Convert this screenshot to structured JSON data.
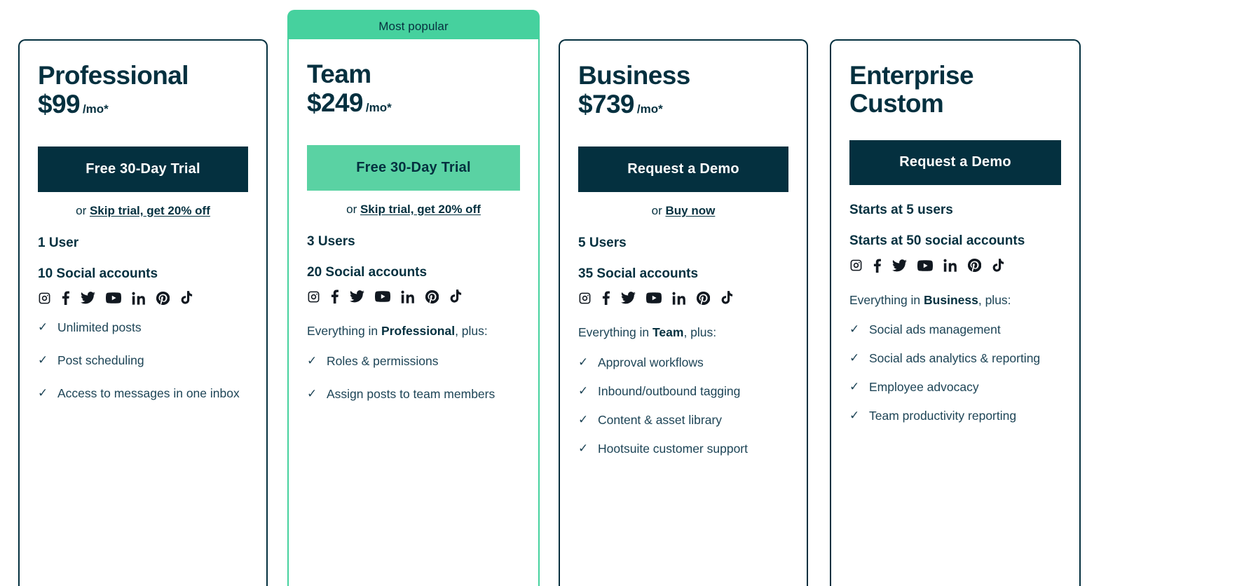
{
  "theme": {
    "dark": "#04303f",
    "green": "#46d19e",
    "button_green": "#5ad2a3",
    "body_text": "#1d4456",
    "card_bg": "#ffffff"
  },
  "badge": {
    "label": "Most popular"
  },
  "social_icons": [
    "instagram-icon",
    "facebook-icon",
    "twitter-icon",
    "youtube-icon",
    "linkedin-icon",
    "pinterest-icon",
    "tiktok-icon"
  ],
  "plans": [
    {
      "name": "Professional",
      "price": "$99",
      "period": "/mo*",
      "cta": "Free 30-Day Trial",
      "or_prefix": "or ",
      "or_link": "Skip trial, get 20% off",
      "users": "1 User",
      "accounts": "10 Social accounts",
      "everything_prefix": "",
      "everything_bold": "",
      "everything_suffix": "",
      "features": [
        "Unlimited posts",
        "Post scheduling",
        "Access to messages in one inbox"
      ]
    },
    {
      "name": "Team",
      "price": "$249",
      "period": "/mo*",
      "cta": "Free 30-Day Trial",
      "or_prefix": "or ",
      "or_link": "Skip trial, get 20% off",
      "users": "3 Users",
      "accounts": "20 Social accounts",
      "everything_prefix": "Everything in ",
      "everything_bold": "Professional",
      "everything_suffix": ", plus:",
      "features": [
        "Roles & permissions",
        "Assign posts to team members"
      ]
    },
    {
      "name": "Business",
      "price": "$739",
      "period": "/mo*",
      "cta": "Request a Demo",
      "or_prefix": "or ",
      "or_link": "Buy now",
      "users": "5 Users",
      "accounts": "35 Social accounts",
      "everything_prefix": "Everything in ",
      "everything_bold": "Team",
      "everything_suffix": ", plus:",
      "features": [
        "Approval workflows",
        "Inbound/outbound tagging",
        "Content & asset library",
        "Hootsuite customer support"
      ]
    },
    {
      "name": "Enterprise",
      "price": "Custom",
      "period": "",
      "cta": "Request a Demo",
      "or_prefix": "",
      "or_link": "",
      "users": "Starts at 5 users",
      "accounts": "Starts at 50 social accounts",
      "everything_prefix": "Everything in ",
      "everything_bold": "Business",
      "everything_suffix": ", plus:",
      "features": [
        "Social ads management",
        "Social ads analytics & reporting",
        "Employee advocacy",
        "Team productivity reporting"
      ]
    }
  ],
  "icons": {
    "check": "✓"
  }
}
